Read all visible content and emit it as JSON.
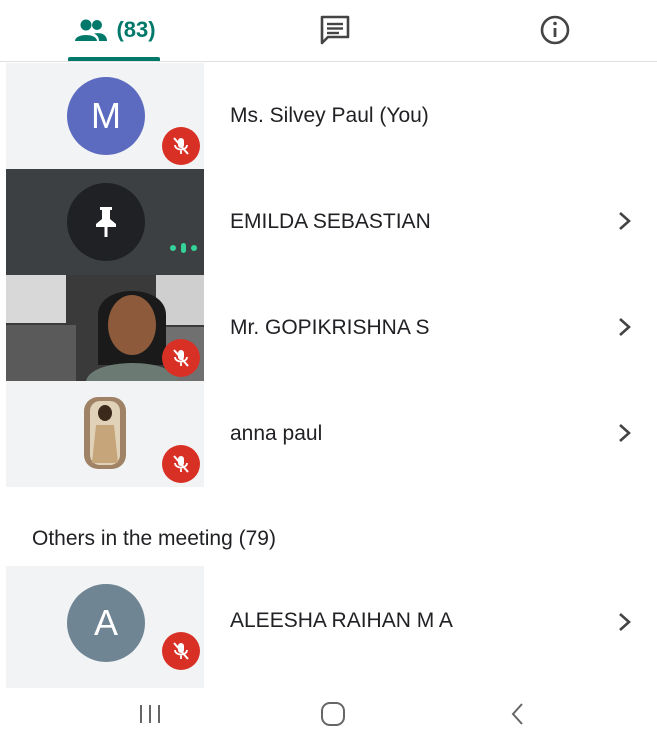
{
  "tabs": {
    "people_count": "(83)",
    "people_icon": "people-icon",
    "chat_icon": "chat-icon",
    "info_icon": "info-icon"
  },
  "participants": [
    {
      "initial": "M",
      "name": "Ms. Silvey Paul (You)",
      "avatar_color": "#5c6bc0",
      "muted": true
    },
    {
      "name": "EMILDA SEBASTIAN",
      "pinned_icon": "pin-icon",
      "speaking": true
    },
    {
      "name": "Mr. GOPIKRISHNA S",
      "muted": true
    },
    {
      "name": "anna paul",
      "muted": true
    }
  ],
  "others": {
    "header": "Others in the meeting (79)",
    "participants": [
      {
        "initial": "A",
        "name": "ALEESHA RAIHAN M A",
        "avatar_color": "#6f8593",
        "muted": true
      }
    ]
  },
  "colors": {
    "accent": "#00796b",
    "mute": "#d93025",
    "speaking": "#34d399"
  },
  "nav": {
    "recents_icon": "recents-icon",
    "home_icon": "home-icon",
    "back_icon": "back-icon"
  }
}
